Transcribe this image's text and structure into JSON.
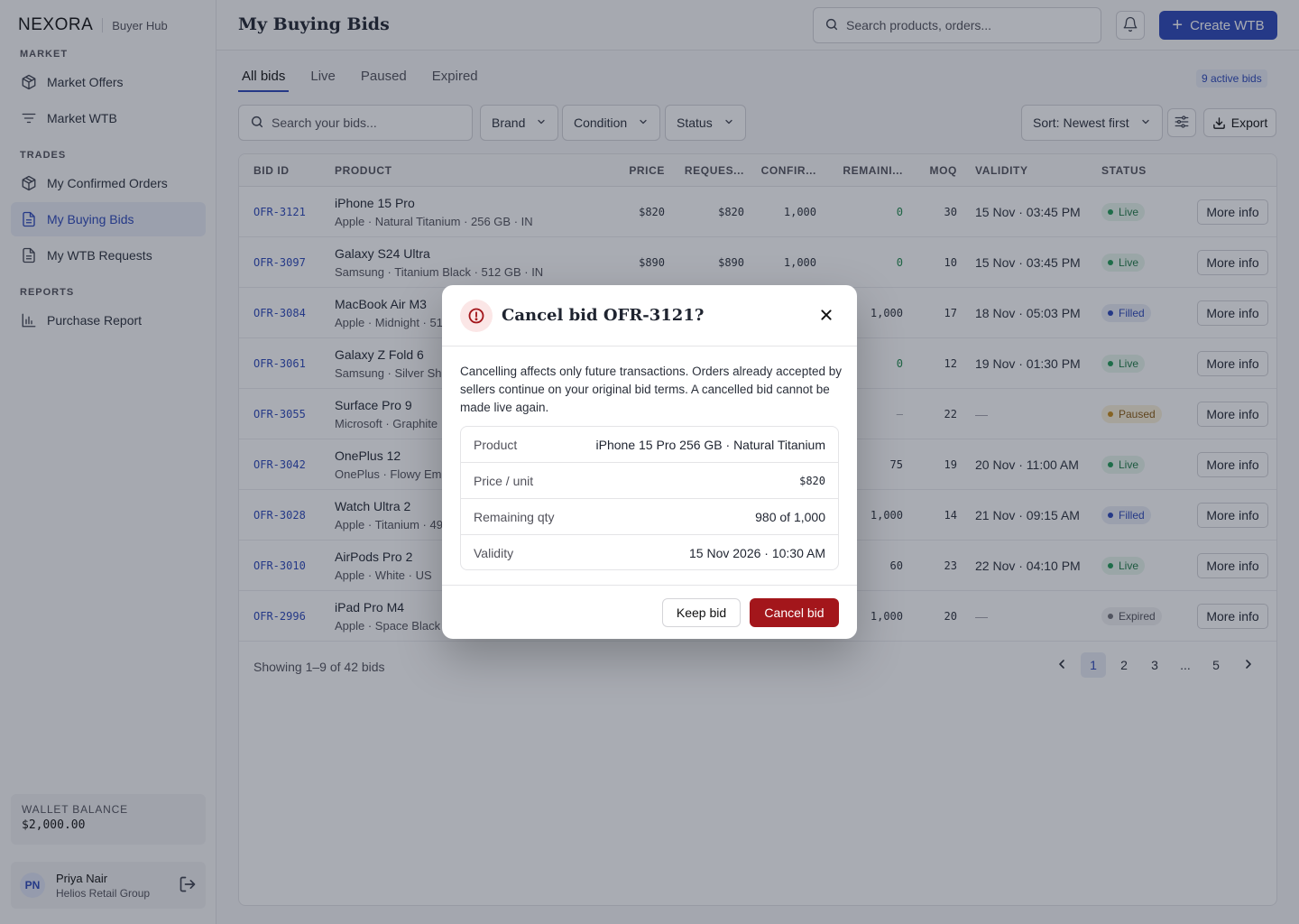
{
  "app": {
    "brand": "NEXORA",
    "subtitle": "Buyer Hub"
  },
  "sidebar": {
    "sections": [
      {
        "title": "MARKET",
        "items": [
          {
            "label": "Market Offers",
            "icon": "box-icon"
          },
          {
            "label": "Market WTB",
            "icon": "filter-lines-icon"
          }
        ]
      },
      {
        "title": "TRADES",
        "items": [
          {
            "label": "My Confirmed Orders",
            "icon": "box-icon"
          },
          {
            "label": "My Buying Bids",
            "icon": "document-icon",
            "active": true
          },
          {
            "label": "My WTB Requests",
            "icon": "document-icon"
          }
        ]
      },
      {
        "title": "REPORTS",
        "items": [
          {
            "label": "Purchase Report",
            "icon": "bar-chart-icon"
          }
        ]
      }
    ],
    "wallet": {
      "label": "WALLET BALANCE",
      "value": "$2,000.00"
    },
    "user": {
      "initials": "PN",
      "name": "Priya Nair",
      "org": "Helios Retail Group"
    }
  },
  "header": {
    "title": "My Buying Bids",
    "search_placeholder": "Search products, orders...",
    "create_label": "Create WTB"
  },
  "tabs": [
    {
      "label": "All bids",
      "active": true
    },
    {
      "label": "Live"
    },
    {
      "label": "Paused"
    },
    {
      "label": "Expired"
    }
  ],
  "active_count": "9 active bids",
  "filters": {
    "search_placeholder": "Search your bids...",
    "brand": "Brand",
    "condition": "Condition",
    "status": "Status",
    "sort": "Sort: Newest first",
    "export": "Export"
  },
  "table": {
    "columns": [
      "BID ID",
      "PRODUCT",
      "PRICE",
      "REQUES...",
      "CONFIR...",
      "REMAINI...",
      "MOQ",
      "VALIDITY",
      "STATUS"
    ],
    "rows": [
      {
        "id": "OFR-3121",
        "name": "iPhone 15 Pro",
        "sub": "Apple · Natural Titanium · 256 GB · IN",
        "price": "$820",
        "requested": "$820",
        "confirmed": "1,000",
        "remaining": "0",
        "moq": "30",
        "validity": "15 Nov · 03:45 PM",
        "status": "Live",
        "more": "More info"
      },
      {
        "id": "OFR-3097",
        "name": "Galaxy S24 Ultra",
        "sub": "Samsung · Titanium Black · 512 GB · IN",
        "price": "$890",
        "requested": "$890",
        "confirmed": "1,000",
        "remaining": "0",
        "moq": "10",
        "validity": "15 Nov · 03:45 PM",
        "status": "Live",
        "more": "More info"
      },
      {
        "id": "OFR-3084",
        "name": "MacBook Air M3",
        "sub": "Apple · Midnight · 51",
        "price": "",
        "requested": "",
        "confirmed": "",
        "remaining": "1,000",
        "moq": "17",
        "validity": "18 Nov · 05:03 PM",
        "status": "Filled",
        "more": "More info"
      },
      {
        "id": "OFR-3061",
        "name": "Galaxy Z Fold 6",
        "sub": "Samsung · Silver Sha",
        "price": "",
        "requested": "",
        "confirmed": "",
        "remaining": "0",
        "moq": "12",
        "validity": "19 Nov · 01:30 PM",
        "status": "Live",
        "more": "More info"
      },
      {
        "id": "OFR-3055",
        "name": "Surface Pro 9",
        "sub": "Microsoft · Graphite",
        "price": "",
        "requested": "",
        "confirmed": "",
        "remaining": "—",
        "moq": "22",
        "validity": "—",
        "status": "Paused",
        "more": "More info"
      },
      {
        "id": "OFR-3042",
        "name": "OnePlus 12",
        "sub": "OnePlus · Flowy Eme",
        "price": "",
        "requested": "",
        "confirmed": "",
        "remaining": "75",
        "moq": "19",
        "validity": "20 Nov · 11:00 AM",
        "status": "Live",
        "more": "More info"
      },
      {
        "id": "OFR-3028",
        "name": "Watch Ultra 2",
        "sub": "Apple · Titanium · 49",
        "price": "",
        "requested": "",
        "confirmed": "",
        "remaining": "1,000",
        "moq": "14",
        "validity": "21 Nov · 09:15 AM",
        "status": "Filled",
        "more": "More info"
      },
      {
        "id": "OFR-3010",
        "name": "AirPods Pro 2",
        "sub": "Apple · White · US",
        "price": "",
        "requested": "",
        "confirmed": "",
        "remaining": "60",
        "moq": "23",
        "validity": "22 Nov · 04:10 PM",
        "status": "Live",
        "more": "More info"
      },
      {
        "id": "OFR-2996",
        "name": "iPad Pro M4",
        "sub": "Apple · Space Black",
        "price": "",
        "requested": "",
        "confirmed": "",
        "remaining": "1,000",
        "moq": "20",
        "validity": "—",
        "status": "Expired",
        "more": "More info"
      }
    ],
    "showing": "Showing 1–9 of 42 bids",
    "pages": [
      "1",
      "2",
      "3",
      "...",
      "5"
    ]
  },
  "modal": {
    "title": "Cancel bid OFR-3121?",
    "description": "Cancelling affects only future transactions. Orders already accepted by sellers continue on your original bid terms. A cancelled bid cannot be made live again.",
    "details": [
      {
        "key": "Product",
        "value": "iPhone 15 Pro 256 GB · Natural Titanium"
      },
      {
        "key": "Price / unit",
        "value": "$820"
      },
      {
        "key": "Remaining qty",
        "value": "980 of 1,000"
      },
      {
        "key": "Validity",
        "value": "15 Nov 2026 · 10:30 AM"
      }
    ],
    "keep_label": "Keep bid",
    "cancel_label": "Cancel bid"
  },
  "colors": {
    "accent": "#2a46b8",
    "danger": "#a3161b",
    "live": "#1f9a55",
    "paused": "#c78a18"
  }
}
